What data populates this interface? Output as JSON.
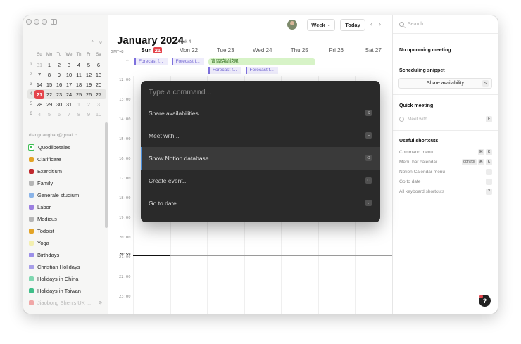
{
  "mini_calendar": {
    "nav_prev": "^",
    "nav_next": "v",
    "weekday_headers": [
      "Su",
      "Mo",
      "Tu",
      "We",
      "Th",
      "Fr",
      "Sa"
    ],
    "weeks": [
      {
        "week": "1",
        "days": [
          "31",
          "1",
          "2",
          "3",
          "4",
          "5",
          "6"
        ]
      },
      {
        "week": "2",
        "days": [
          "7",
          "8",
          "9",
          "10",
          "11",
          "12",
          "13"
        ]
      },
      {
        "week": "3",
        "days": [
          "14",
          "15",
          "16",
          "17",
          "18",
          "19",
          "20"
        ]
      },
      {
        "week": "4",
        "days": [
          "21",
          "22",
          "23",
          "24",
          "25",
          "26",
          "27"
        ]
      },
      {
        "week": "5",
        "days": [
          "28",
          "29",
          "30",
          "31",
          "1",
          "2",
          "3"
        ]
      },
      {
        "week": "6",
        "days": [
          "4",
          "5",
          "6",
          "7",
          "8",
          "9",
          "10"
        ]
      }
    ]
  },
  "sidebar": {
    "account": "dianguanghan@gmail.c...",
    "calendars": [
      {
        "label": "Quodlibetales",
        "color": "#3fbe55"
      },
      {
        "label": "Clarificare",
        "color": "#e3a427"
      },
      {
        "label": "Exercitium",
        "color": "#c0282d"
      },
      {
        "label": "Family",
        "color": "#b6b6b6"
      },
      {
        "label": "Generale studium",
        "color": "#8ab4e8"
      },
      {
        "label": "Labor",
        "color": "#9b7fe0"
      },
      {
        "label": "Medicus",
        "color": "#b6b6b6"
      },
      {
        "label": "Todoist",
        "color": "#e3a427"
      },
      {
        "label": "Yoga",
        "color": "#f3efb0"
      },
      {
        "label": "Birthdays",
        "color": "#9b8fe8"
      },
      {
        "label": "Christian Holidays",
        "color": "#a79ee8"
      },
      {
        "label": "Holidays in China",
        "color": "#7fd7b0"
      },
      {
        "label": "Holidays in Taiwan",
        "color": "#3fbe89"
      },
      {
        "label": "Jiaobong Shen's UK ...",
        "color": "#f0a7a7",
        "hidden": true
      }
    ]
  },
  "header": {
    "view_label": "Week",
    "today_label": "Today",
    "prev_arrow": "‹",
    "next_arrow": "›",
    "month_title": "January 2024",
    "week_label": "Week 4",
    "timezone": "GMT+8",
    "days": [
      {
        "name": "Sun",
        "num": "21",
        "today": true
      },
      {
        "name": "Mon",
        "num": "22"
      },
      {
        "name": "Tue",
        "num": "23"
      },
      {
        "name": "Wed",
        "num": "24"
      },
      {
        "name": "Thu",
        "num": "25"
      },
      {
        "name": "Fri",
        "num": "26"
      },
      {
        "name": "Sat",
        "num": "27"
      }
    ]
  },
  "all_day_events": [
    {
      "label": "Forecast f...",
      "type": "fc",
      "day": 0,
      "row": 0
    },
    {
      "label": "Forecast f...",
      "type": "fc",
      "day": 1,
      "row": 0
    },
    {
      "label": "實習時尚炫風",
      "type": "green",
      "day": 2,
      "span": 3,
      "row": 0
    },
    {
      "label": "Forecast f...",
      "type": "fc",
      "day": 2,
      "row": 1
    },
    {
      "label": "Forecast f...",
      "type": "fc",
      "day": 3,
      "row": 1
    }
  ],
  "time_labels": [
    "12:00",
    "13:00",
    "14:00",
    "15:00",
    "16:00",
    "17:00",
    "18:00",
    "19:00",
    "20:00",
    "21:00",
    "22:00",
    "23:00"
  ],
  "current_time": "20:59",
  "current_time_fraction_of_hour": 0.98,
  "command_palette": {
    "placeholder": "Type a command...",
    "items": [
      {
        "label": "Share availabilities...",
        "key": "S"
      },
      {
        "label": "Meet with...",
        "key": "F"
      },
      {
        "label": "Show Notion database...",
        "key": "O",
        "selected": true
      },
      {
        "label": "Create event...",
        "key": "C"
      },
      {
        "label": "Go to date...",
        "key": "."
      }
    ]
  },
  "right_panel": {
    "search_placeholder": "Search",
    "no_meeting": "No upcoming meeting",
    "scheduling_title": "Scheduling snippet",
    "share_label": "Share availability",
    "share_key": "S",
    "quick_title": "Quick meeting",
    "meet_placeholder": "Meet with...",
    "meet_key": "F",
    "shortcuts_title": "Useful shortcuts",
    "shortcuts": [
      {
        "label": "Command menu",
        "keys": [
          "⌘",
          "K"
        ]
      },
      {
        "label": "Menu bar calendar",
        "keys": [
          "control",
          "⌘",
          "K"
        ]
      },
      {
        "label": "Notion Calendar menu",
        "keys": [
          "!"
        ]
      },
      {
        "label": "Go to date",
        "keys": [
          "."
        ]
      },
      {
        "label": "All keyboard shortcuts",
        "keys": [
          "?"
        ]
      }
    ]
  },
  "help_button": "?"
}
